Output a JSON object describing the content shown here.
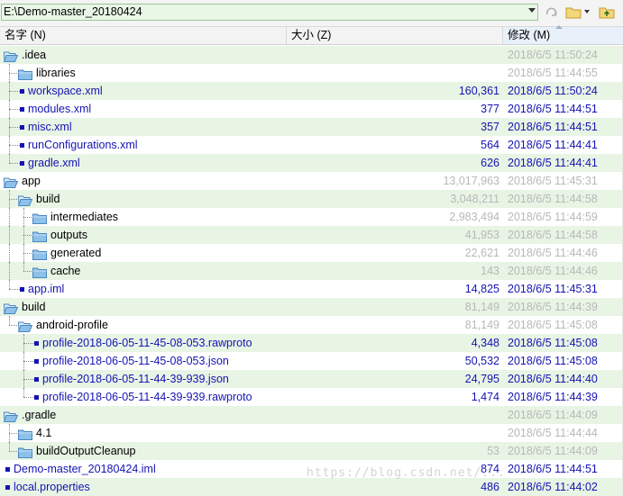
{
  "path_bar": {
    "path_value": "E:\\Demo-master_20180424"
  },
  "columns": {
    "name": "名字 (N)",
    "size": "大小 (Z)",
    "modified": "修改 (M)"
  },
  "rows": [
    {
      "depth": 0,
      "type": "folder",
      "open": true,
      "name": ".idea",
      "size": "",
      "date": "2018/6/5 11:50:24",
      "gray": true
    },
    {
      "depth": 1,
      "type": "folder",
      "open": false,
      "name": "libraries",
      "size": "",
      "date": "2018/6/5 11:44:55",
      "gray": true
    },
    {
      "depth": 1,
      "type": "file",
      "name": "workspace.xml",
      "size": "160,361",
      "date": "2018/6/5 11:50:24",
      "gray": false
    },
    {
      "depth": 1,
      "type": "file",
      "name": "modules.xml",
      "size": "377",
      "date": "2018/6/5 11:44:51",
      "gray": false
    },
    {
      "depth": 1,
      "type": "file",
      "name": "misc.xml",
      "size": "357",
      "date": "2018/6/5 11:44:51",
      "gray": false
    },
    {
      "depth": 1,
      "type": "file",
      "name": "runConfigurations.xml",
      "size": "564",
      "date": "2018/6/5 11:44:41",
      "gray": false
    },
    {
      "depth": 1,
      "type": "file",
      "name": "gradle.xml",
      "size": "626",
      "date": "2018/6/5 11:44:41",
      "gray": false
    },
    {
      "depth": 0,
      "type": "folder",
      "open": true,
      "name": "app",
      "size": "13,017,963",
      "date": "2018/6/5 11:45:31",
      "gray": true
    },
    {
      "depth": 1,
      "type": "folder",
      "open": true,
      "name": "build",
      "size": "3,048,211",
      "date": "2018/6/5 11:44:58",
      "gray": true
    },
    {
      "depth": 2,
      "type": "folder",
      "open": false,
      "name": "intermediates",
      "size": "2,983,494",
      "date": "2018/6/5 11:44:59",
      "gray": true
    },
    {
      "depth": 2,
      "type": "folder",
      "open": false,
      "name": "outputs",
      "size": "41,953",
      "date": "2018/6/5 11:44:58",
      "gray": true
    },
    {
      "depth": 2,
      "type": "folder",
      "open": false,
      "name": "generated",
      "size": "22,621",
      "date": "2018/6/5 11:44:46",
      "gray": true
    },
    {
      "depth": 2,
      "type": "folder",
      "open": false,
      "name": "cache",
      "size": "143",
      "date": "2018/6/5 11:44:46",
      "gray": true
    },
    {
      "depth": 1,
      "type": "file",
      "name": "app.iml",
      "size": "14,825",
      "date": "2018/6/5 11:45:31",
      "gray": false
    },
    {
      "depth": 0,
      "type": "folder",
      "open": true,
      "name": "build",
      "size": "81,149",
      "date": "2018/6/5 11:44:39",
      "gray": true
    },
    {
      "depth": 1,
      "type": "folder",
      "open": true,
      "name": "android-profile",
      "size": "81,149",
      "date": "2018/6/5 11:45:08",
      "gray": true
    },
    {
      "depth": 2,
      "type": "file",
      "name": "profile-2018-06-05-11-45-08-053.rawproto",
      "size": "4,348",
      "date": "2018/6/5 11:45:08",
      "gray": false
    },
    {
      "depth": 2,
      "type": "file",
      "name": "profile-2018-06-05-11-45-08-053.json",
      "size": "50,532",
      "date": "2018/6/5 11:45:08",
      "gray": false
    },
    {
      "depth": 2,
      "type": "file",
      "name": "profile-2018-06-05-11-44-39-939.json",
      "size": "24,795",
      "date": "2018/6/5 11:44:40",
      "gray": false
    },
    {
      "depth": 2,
      "type": "file",
      "name": "profile-2018-06-05-11-44-39-939.rawproto",
      "size": "1,474",
      "date": "2018/6/5 11:44:39",
      "gray": false
    },
    {
      "depth": 0,
      "type": "folder",
      "open": true,
      "name": ".gradle",
      "size": "",
      "date": "2018/6/5 11:44:09",
      "gray": true
    },
    {
      "depth": 1,
      "type": "folder",
      "open": false,
      "name": "4.1",
      "size": "",
      "date": "2018/6/5 11:44:44",
      "gray": true
    },
    {
      "depth": 1,
      "type": "folder",
      "open": false,
      "name": "buildOutputCleanup",
      "size": "53",
      "date": "2018/6/5 11:44:09",
      "gray": true
    },
    {
      "depth": 0,
      "type": "file",
      "name": "Demo-master_20180424.iml",
      "size": "874",
      "date": "2018/6/5 11:44:51",
      "gray": false
    },
    {
      "depth": 0,
      "type": "file",
      "name": "local.properties",
      "size": "486",
      "date": "2018/6/5 11:44:02",
      "gray": false
    }
  ],
  "watermark": "https://blog.csdn.net/...",
  "colors": {
    "file_text": "#1414b4",
    "dim_text": "#b8b8b8",
    "row_alt": "#e8f4e4",
    "path_bg": "#e9f7e6",
    "folder": "#6aa7d8"
  }
}
